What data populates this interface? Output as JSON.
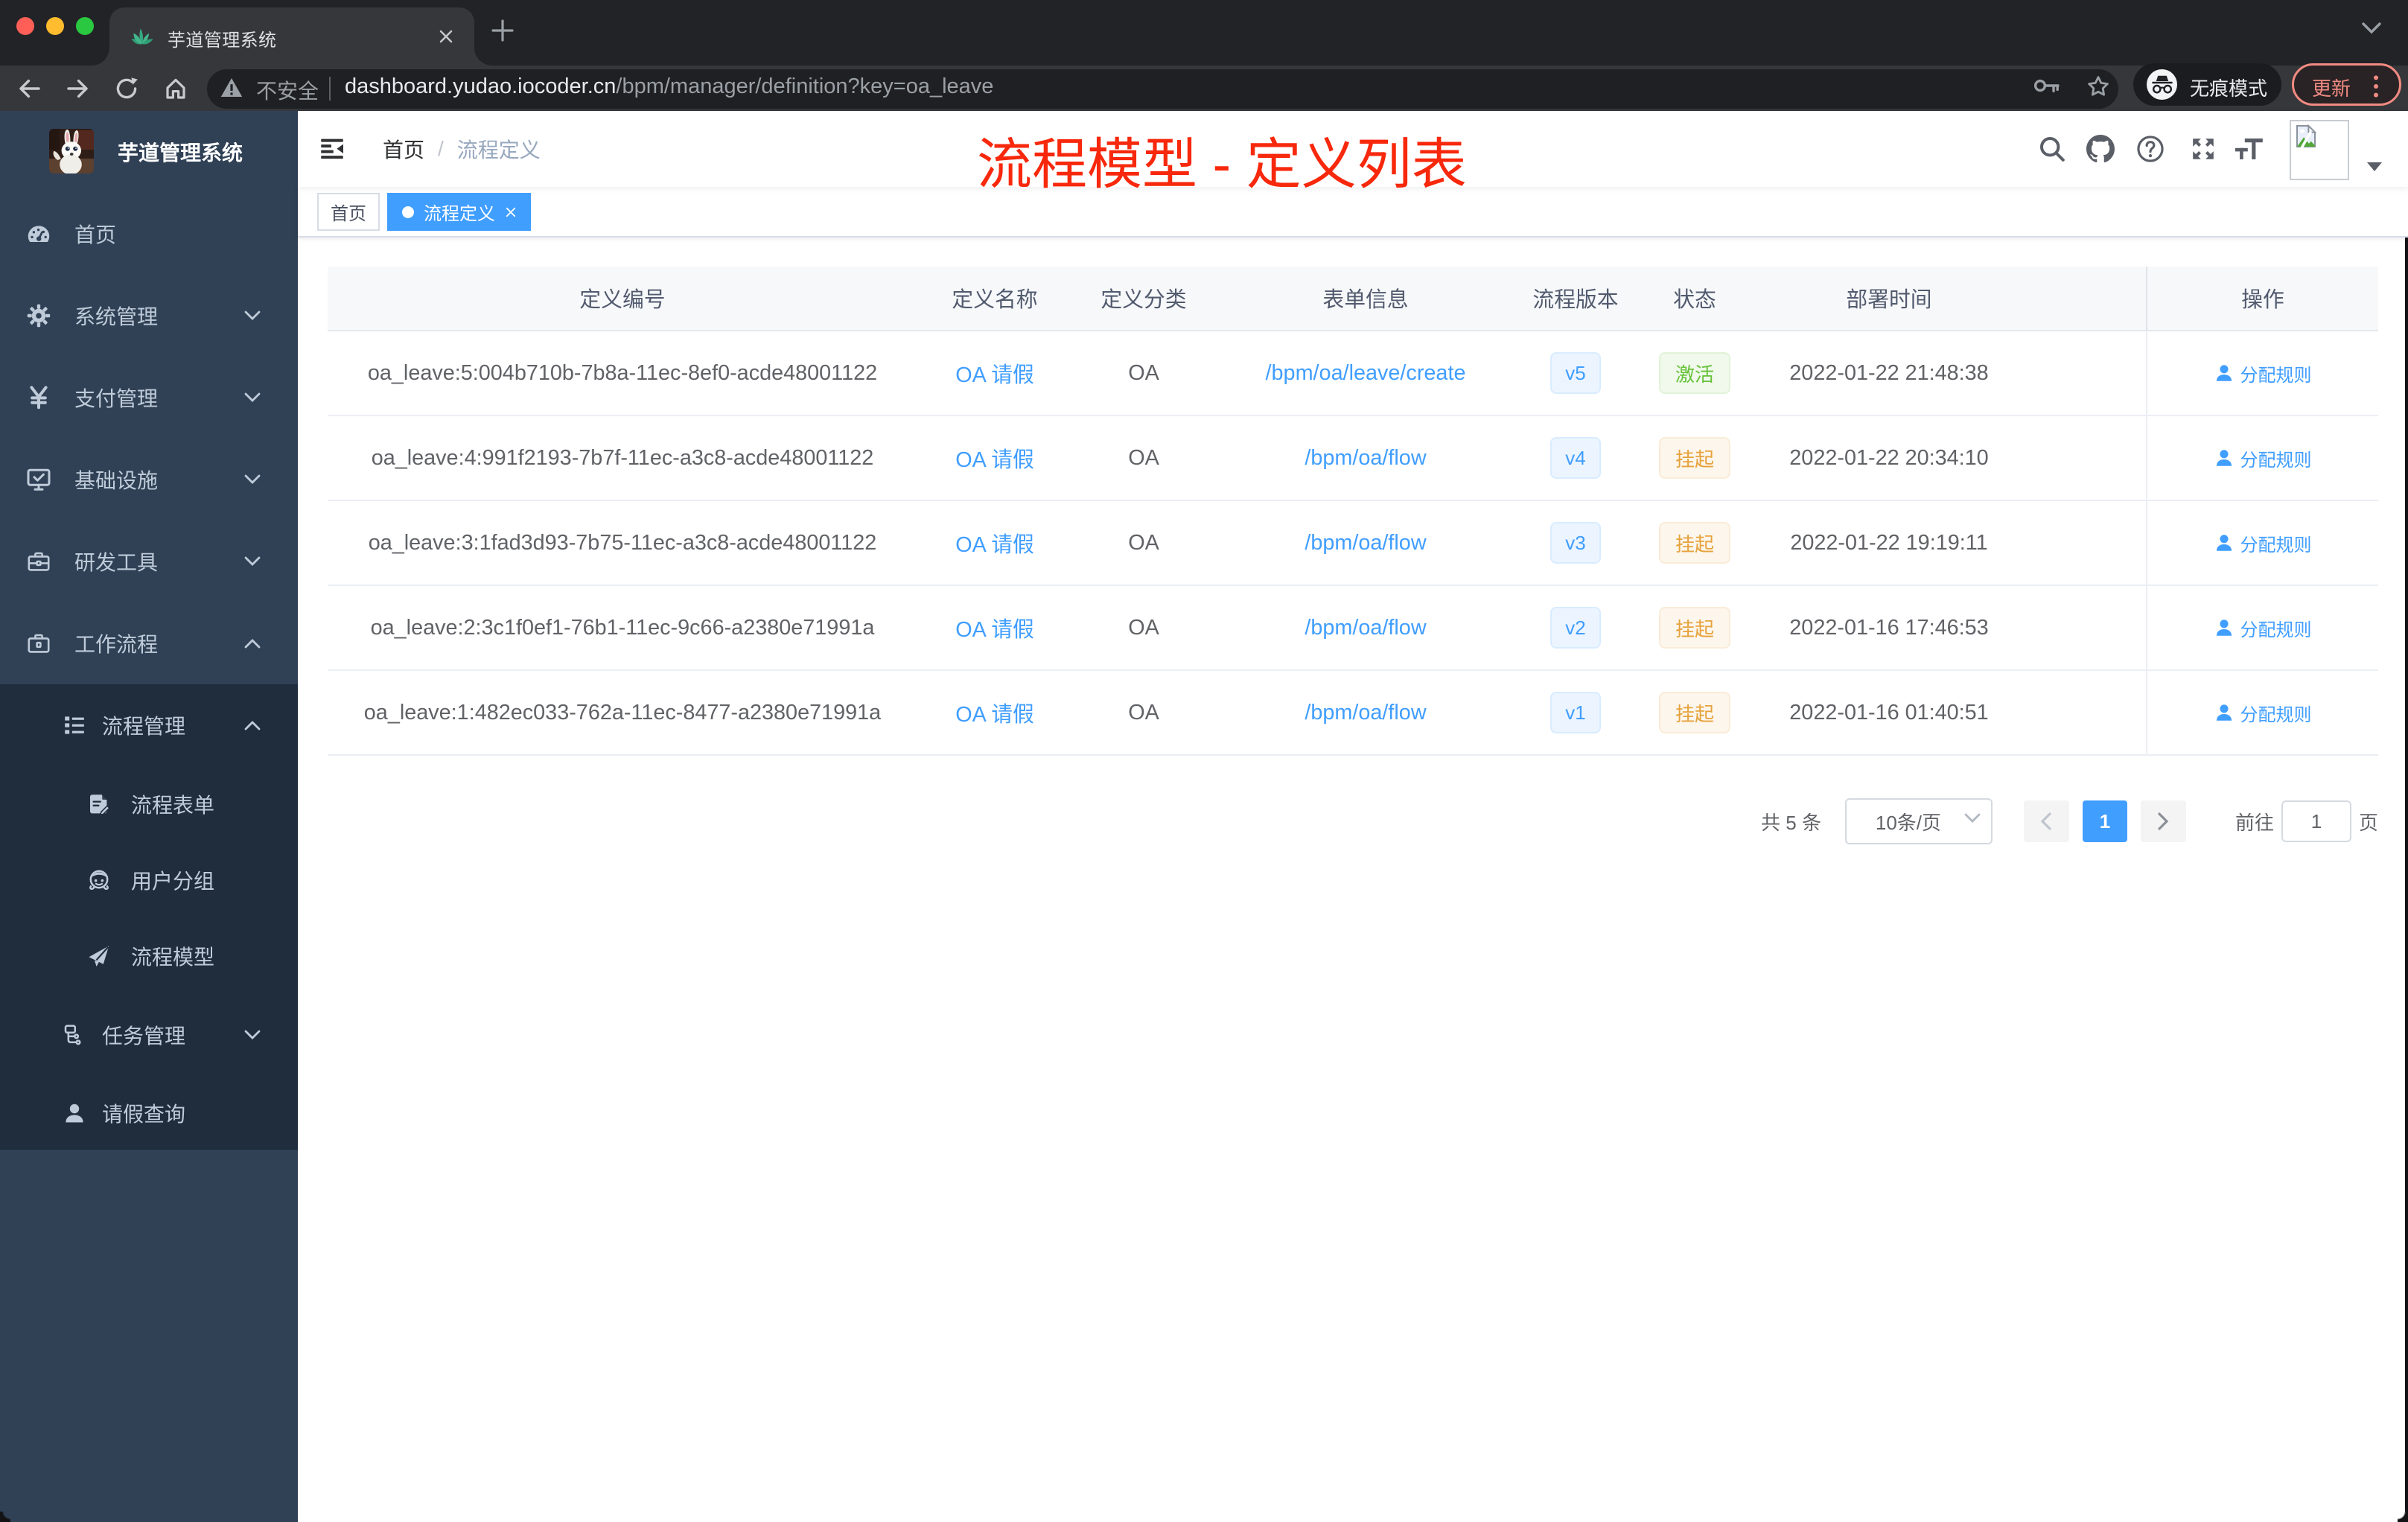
{
  "browser": {
    "tab_title": "芋道管理系统",
    "url_security": "不安全",
    "url_host": "dashboard.yudao.iocoder.cn",
    "url_path": "/bpm/manager/definition?key=oa_leave",
    "incognito_label": "无痕模式",
    "update_label": "更新"
  },
  "sidebar": {
    "logo_title": "芋道管理系统",
    "items": [
      {
        "label": "首页",
        "icon": "dashboard-icon"
      },
      {
        "label": "系统管理",
        "icon": "gear-icon"
      },
      {
        "label": "支付管理",
        "icon": "yen-icon"
      },
      {
        "label": "基础设施",
        "icon": "monitor-icon"
      },
      {
        "label": "研发工具",
        "icon": "toolbox-icon"
      },
      {
        "label": "工作流程",
        "icon": "briefcase-icon"
      }
    ],
    "workflow_children": {
      "process_group": {
        "label": "流程管理",
        "icon": "tree-table-icon"
      },
      "process_items": [
        {
          "label": "流程表单",
          "icon": "form-icon"
        },
        {
          "label": "用户分组",
          "icon": "people-icon"
        },
        {
          "label": "流程模型",
          "icon": "paper-plane-icon"
        }
      ],
      "task_group": {
        "label": "任务管理",
        "icon": "tree-icon"
      },
      "leave_item": {
        "label": "请假查询",
        "icon": "person-icon"
      }
    }
  },
  "navbar": {
    "breadcrumb": {
      "home": "首页",
      "separator": "/",
      "current": "流程定义"
    }
  },
  "tags": [
    {
      "label": "首页",
      "active": false
    },
    {
      "label": "流程定义",
      "active": true,
      "closable": true
    }
  ],
  "annotation": {
    "text": "流程模型 - 定义列表",
    "color": "#f7280c"
  },
  "table": {
    "headers": [
      "定义编号",
      "定义名称",
      "定义分类",
      "表单信息",
      "流程版本",
      "状态",
      "部署时间",
      "操作"
    ],
    "action_label": "分配规则",
    "rows": [
      {
        "id": "oa_leave:5:004b710b-7b8a-11ec-8ef0-acde48001122",
        "name": "OA 请假",
        "category": "OA",
        "form": "/bpm/oa/leave/create",
        "version": "v5",
        "status": "激活",
        "status_type": "success",
        "time": "2022-01-22 21:48:38"
      },
      {
        "id": "oa_leave:4:991f2193-7b7f-11ec-a3c8-acde48001122",
        "name": "OA 请假",
        "category": "OA",
        "form": "/bpm/oa/flow",
        "version": "v4",
        "status": "挂起",
        "status_type": "warning",
        "time": "2022-01-22 20:34:10"
      },
      {
        "id": "oa_leave:3:1fad3d93-7b75-11ec-a3c8-acde48001122",
        "name": "OA 请假",
        "category": "OA",
        "form": "/bpm/oa/flow",
        "version": "v3",
        "status": "挂起",
        "status_type": "warning",
        "time": "2022-01-22 19:19:11"
      },
      {
        "id": "oa_leave:2:3c1f0ef1-76b1-11ec-9c66-a2380e71991a",
        "name": "OA 请假",
        "category": "OA",
        "form": "/bpm/oa/flow",
        "version": "v2",
        "status": "挂起",
        "status_type": "warning",
        "time": "2022-01-16 17:46:53"
      },
      {
        "id": "oa_leave:1:482ec033-762a-11ec-8477-a2380e71991a",
        "name": "OA 请假",
        "category": "OA",
        "form": "/bpm/oa/flow",
        "version": "v1",
        "status": "挂起",
        "status_type": "warning",
        "time": "2022-01-16 01:40:51"
      }
    ]
  },
  "pagination": {
    "total": "共 5 条",
    "page_size": "10条/页",
    "current_page": "1",
    "goto_label": "前往",
    "goto_value": "1",
    "page_unit": "页"
  },
  "colors": {
    "primary": "#409eff",
    "success": "#67c23a",
    "warning": "#e6a23c",
    "sidebar_bg": "#304156",
    "submenu_bg": "#1f2d3d",
    "annotation_red": "#f7280c"
  }
}
